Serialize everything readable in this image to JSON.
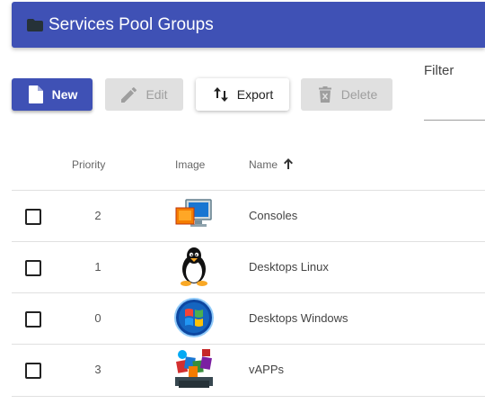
{
  "header": {
    "title": "Services Pool Groups",
    "icon": "folder-icon"
  },
  "toolbar": {
    "new_label": "New",
    "edit_label": "Edit",
    "export_label": "Export",
    "delete_label": "Delete"
  },
  "filter": {
    "label": "Filter",
    "value": ""
  },
  "table": {
    "columns": {
      "priority": "Priority",
      "image": "Image",
      "name": "Name",
      "sort_icon": "arrow-up-icon"
    },
    "rows": [
      {
        "priority": "2",
        "image": "monitor-icon",
        "name": "Consoles"
      },
      {
        "priority": "1",
        "image": "linux-penguin-icon",
        "name": "Desktops Linux"
      },
      {
        "priority": "0",
        "image": "windows-logo-icon",
        "name": "Desktops Windows"
      },
      {
        "priority": "3",
        "image": "office-apps-icon",
        "name": "vAPPs"
      }
    ]
  },
  "colors": {
    "primary": "#3f51b5",
    "disabled_bg": "#e0e0e0",
    "disabled_text": "#9e9e9e"
  }
}
